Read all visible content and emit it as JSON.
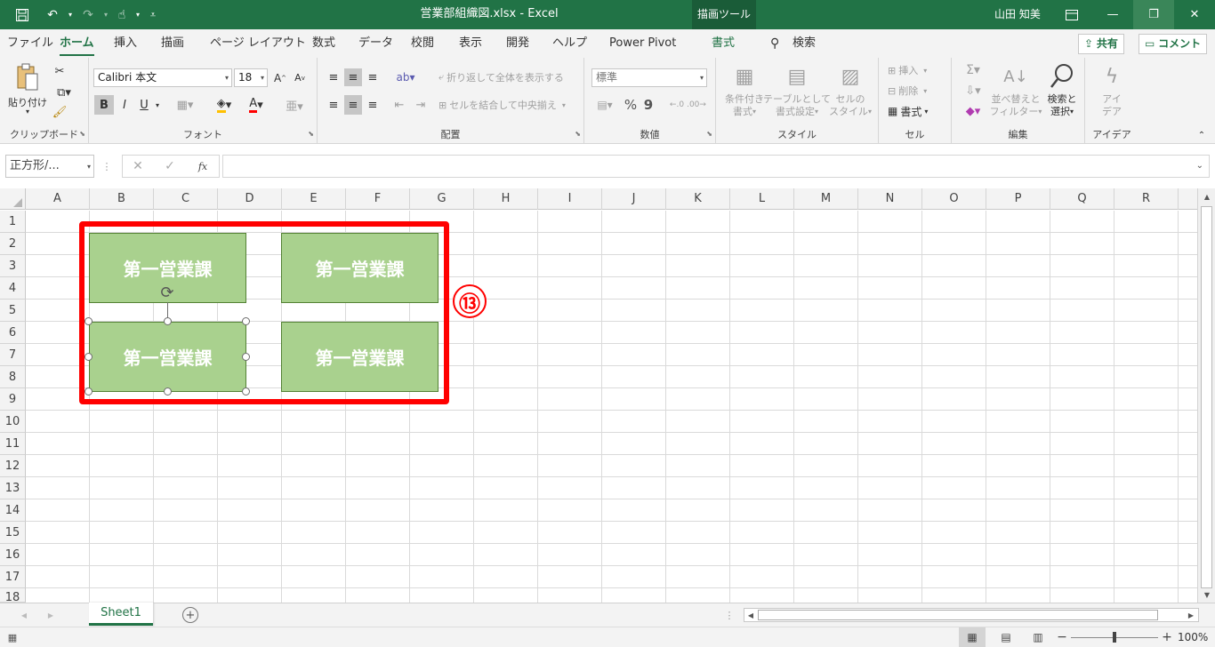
{
  "app": {
    "window_title": "営業部組織図.xlsx  -  Excel",
    "contextual_tab": "描画ツール",
    "user": "山田 知美"
  },
  "tabs": [
    "ファイル",
    "ホーム",
    "挿入",
    "描画",
    "ページ レイアウト",
    "数式",
    "データ",
    "校閲",
    "表示",
    "開発",
    "ヘルプ",
    "Power Pivot",
    "書式"
  ],
  "search_label": "検索",
  "share_label": "共有",
  "comment_label": "コメント",
  "ribbon": {
    "clipboard": {
      "paste": "貼り付け",
      "label": "クリップボード"
    },
    "font": {
      "name": "Calibri 本文",
      "size": "18",
      "bold": "B",
      "italic": "I",
      "underline": "U",
      "grow": "A",
      "shrink": "A",
      "label": "フォント"
    },
    "alignment": {
      "wrap": "折り返して全体を表示する",
      "merge": "セルを結合して中央揃え",
      "label": "配置"
    },
    "number": {
      "format": "標準",
      "percent": "%",
      "comma": "9",
      "label": "数値"
    },
    "styles": {
      "conditional_1": "条件付き",
      "conditional_2": "書式",
      "table_1": "テーブルとして",
      "table_2": "書式設定",
      "cell_1": "セルの",
      "cell_2": "スタイル",
      "label": "スタイル"
    },
    "cells": {
      "insert": "挿入",
      "delete": "削除",
      "format": "書式",
      "label": "セル"
    },
    "editing": {
      "sort_1": "並べ替えと",
      "sort_2": "フィルター",
      "find_1": "検索と",
      "find_2": "選択",
      "label": "編集"
    },
    "ideas": {
      "l1": "アイ",
      "l2": "デア",
      "label": "アイデア"
    }
  },
  "formula_bar": {
    "name_box": "正方形/...",
    "fx": "fx",
    "content": ""
  },
  "columns": [
    "A",
    "B",
    "C",
    "D",
    "E",
    "F",
    "G",
    "H",
    "I",
    "J",
    "K",
    "L",
    "M",
    "N",
    "O",
    "P",
    "Q",
    "R"
  ],
  "rows": [
    "1",
    "2",
    "3",
    "4",
    "5",
    "6",
    "7",
    "8",
    "9",
    "10",
    "11",
    "12",
    "13",
    "14",
    "15",
    "16",
    "17",
    "18"
  ],
  "shapes": [
    {
      "text": "第一営業課"
    },
    {
      "text": "第一営業課"
    },
    {
      "text": "第一営業課"
    },
    {
      "text": "第一営業課"
    }
  ],
  "annotation": {
    "label": "⑬",
    "color": "#ff0000"
  },
  "sheet_tab": "Sheet1",
  "status": {
    "zoom": "100%"
  },
  "colors": {
    "brand": "#217346",
    "shape_fill": "#a9d18e",
    "shape_border": "#548235"
  }
}
